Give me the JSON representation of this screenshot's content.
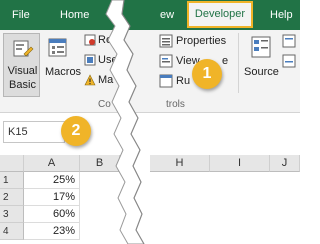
{
  "tabs": {
    "file": "File",
    "home": "Home",
    "view_partial": "ew",
    "developer": "Developer",
    "help": "Help"
  },
  "ribbon": {
    "visual_basic": "Visual Basic",
    "macros": "Macros",
    "record_partial": "Reco",
    "use_partial": "Use R",
    "security_partial": "Ma",
    "properties": "Properties",
    "view_code_partial": "View",
    "view_code_suffix": "e",
    "run_dialog_partial": "Ru",
    "source": "Source",
    "group_code_partial": "Co",
    "group_controls_partial": "trols"
  },
  "name_box": {
    "value": "K15"
  },
  "columns": {
    "a": "A",
    "b": "B",
    "h": "H",
    "i": "I",
    "j": "J"
  },
  "rows": [
    {
      "num": "1",
      "value": "25%"
    },
    {
      "num": "2",
      "value": "17%"
    },
    {
      "num": "3",
      "value": "60%"
    },
    {
      "num": "4",
      "value": "23%"
    }
  ],
  "callouts": {
    "one": "1",
    "two": "2"
  },
  "colors": {
    "ribbon_green": "#217346",
    "highlight": "#f0b428",
    "ribbon_bg": "#f3f3f3"
  }
}
